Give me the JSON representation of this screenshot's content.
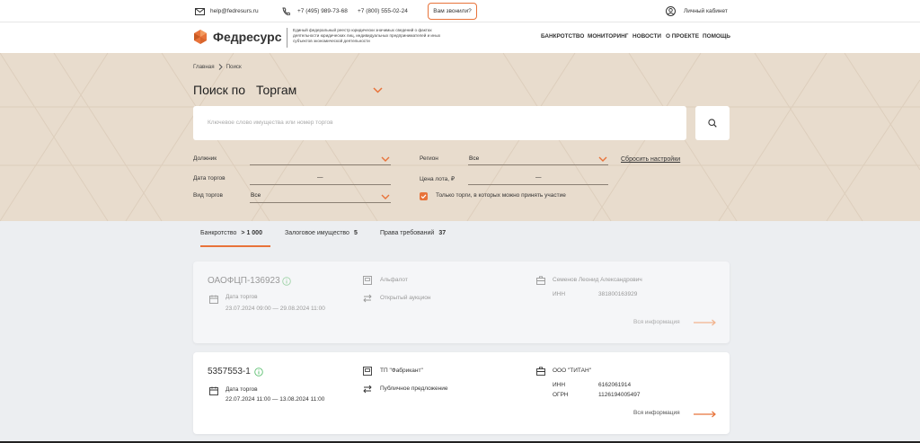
{
  "topbar": {
    "email": "help@fedresurs.ru",
    "phone1": "+7 (495) 989-73-68",
    "phone2": "+7 (800) 555-02-24",
    "callback": "Вам звонили?",
    "account": "Личный кабинет"
  },
  "header": {
    "logo": "Федресурс",
    "description": "Единый федеральный реестр юридически значимых сведений о фактах деятельности юридических лиц, индивидуальных предпринимателей и иных субъектов экономической деятельности",
    "nav": [
      "БАНКРОТСТВО",
      "МОНИТОРИНГ",
      "НОВОСТИ",
      "О ПРОЕКТЕ",
      "ПОМОЩЬ"
    ]
  },
  "breadcrumb": {
    "home": "Главная",
    "current": "Поиск"
  },
  "search": {
    "title": "Поиск по",
    "category": "Торгам",
    "placeholder": "Ключевое слово имущества или номер торгов"
  },
  "filters": {
    "debtor_label": "Должник",
    "date_label": "Дата торгов",
    "date_sep": "—",
    "type_label": "Вид торгов",
    "type_value": "Все",
    "region_label": "Регион",
    "region_value": "Все",
    "price_label": "Цена лота, ₽",
    "price_sep": "—",
    "reset": "Сбросить настройки",
    "only_open": "Только торги, в которых можно принять участие"
  },
  "tabs": [
    {
      "label": "Банкротство",
      "count": "> 1 000"
    },
    {
      "label": "Залоговое имущество",
      "count": "5"
    },
    {
      "label": "Права требований",
      "count": "37"
    }
  ],
  "cards": [
    {
      "number": "ОАОФЦП-136923",
      "date_label": "Дата торгов",
      "date_value": "23.07.2024 09:00 — 29.08.2024 11:00",
      "platform": "Альфалот",
      "type": "Открытый аукцион",
      "debtor": "Семенов Леонид Александрович",
      "inn_label": "ИНН",
      "inn": "381800163929",
      "all_info": "Вся информация"
    },
    {
      "number": "5357553-1",
      "date_label": "Дата торгов",
      "date_value": "22.07.2024 11:00 — 13.08.2024 11:00",
      "platform": "ТП \"Фабрикант\"",
      "type": "Публичное предложение",
      "debtor": "ООО \"ТИТАН\"",
      "inn_label": "ИНН",
      "inn": "6162061914",
      "ogrn_label": "ОГРН",
      "ogrn": "1126194005497",
      "all_info": "Вся информация"
    }
  ],
  "colors": {
    "accent": "#e8733a",
    "hero": "#e8dccd"
  }
}
